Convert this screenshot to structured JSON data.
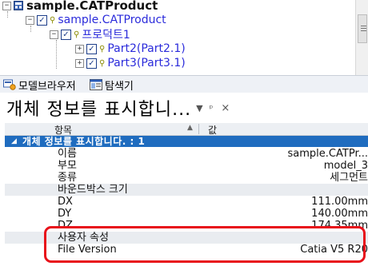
{
  "tree": {
    "root_label": "sample.CATProduct",
    "items": [
      {
        "label": "sample.CATProduct",
        "expander": "−"
      },
      {
        "label": "프로덕트1",
        "expander": "−"
      },
      {
        "label": "Part2(Part2.1)",
        "expander": "+"
      },
      {
        "label": "Part3(Part3.1)",
        "expander": "+"
      }
    ]
  },
  "tabs": [
    {
      "label": "모델브라우저",
      "icon": "model-browser-icon"
    },
    {
      "label": "탐색기",
      "icon": "explorer-icon"
    }
  ],
  "panel": {
    "title": "개체 정보를 표시합니...",
    "dropdown_glyph": "▼",
    "pin_glyph": "ᵖ",
    "close_glyph": "×"
  },
  "grid": {
    "col_item": "항목",
    "col_value": "값",
    "category": "개체 정보를 표시합니다. : 1",
    "rows": [
      {
        "key": "이름",
        "value": "sample.CATPr..."
      },
      {
        "key": "부모",
        "value": "model_3"
      },
      {
        "key": "종류",
        "value": "세그먼트"
      },
      {
        "key": "바운드박스 크기",
        "value": ""
      },
      {
        "key": "DX",
        "value": "111.00mm"
      },
      {
        "key": "DY",
        "value": "140.00mm"
      },
      {
        "key": "DZ",
        "value": "174.35mm"
      },
      {
        "key": "사용자 속성",
        "value": ""
      },
      {
        "key": "File Version",
        "value": "Catia V5 R20"
      }
    ]
  },
  "colors": {
    "category_bg": "#1f6cbf",
    "tree_blue_text": "#2b2bdb",
    "highlight_border": "#e8111a"
  }
}
